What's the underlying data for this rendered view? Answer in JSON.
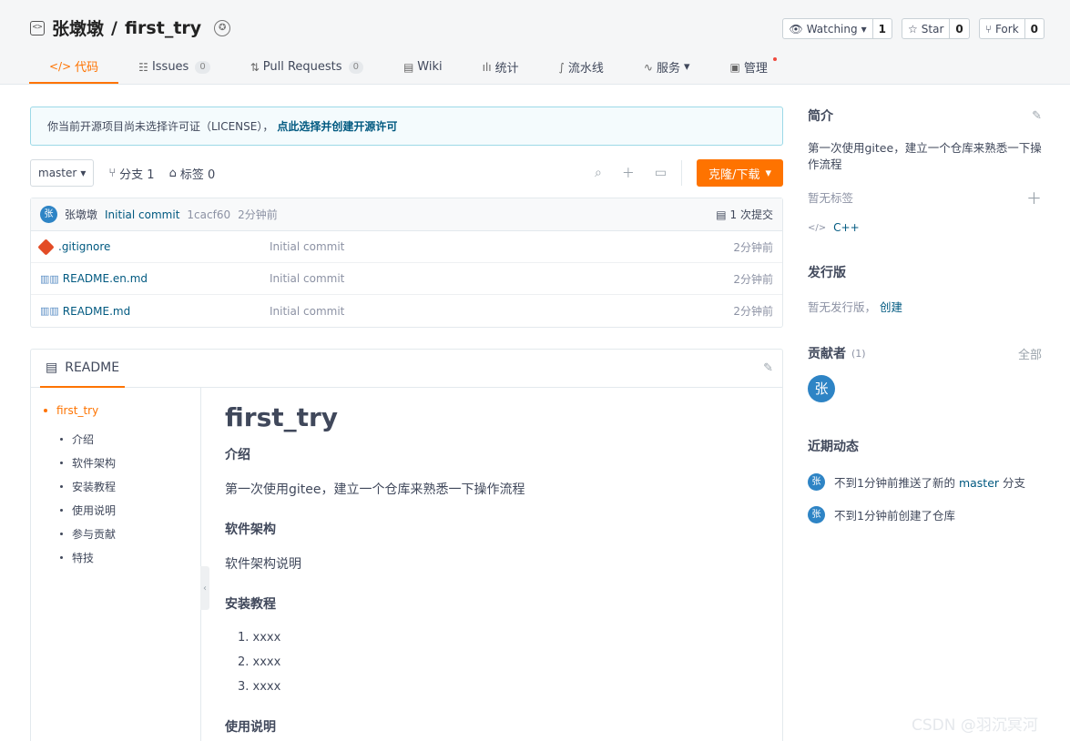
{
  "repo": {
    "owner": "张墩墩",
    "separator": "/",
    "name": "first_try",
    "title_icon": "code-repo-icon",
    "badge_icon": "recommend-badge-icon"
  },
  "actions": {
    "watch_label": "Watching",
    "watch_count": "1",
    "star_label": "Star",
    "star_count": "0",
    "fork_label": "Fork",
    "fork_count": "0"
  },
  "tabs": [
    {
      "label": "代码",
      "icon": "code-icon",
      "active": true
    },
    {
      "label": "Issues",
      "count": "0",
      "icon": "issues-icon"
    },
    {
      "label": "Pull Requests",
      "count": "0",
      "icon": "pull-request-icon"
    },
    {
      "label": "Wiki",
      "icon": "wiki-icon"
    },
    {
      "label": "统计",
      "icon": "chart-icon"
    },
    {
      "label": "流水线",
      "icon": "pipeline-icon"
    },
    {
      "label": "服务",
      "icon": "service-icon"
    },
    {
      "label": "管理",
      "icon": "manage-icon"
    }
  ],
  "license": {
    "text": "你当前开源项目尚未选择许可证（LICENSE），",
    "link": "点此选择并创建开源许可"
  },
  "branchbar": {
    "branch": "master",
    "branches_label": "分支 1",
    "tags_label": "标签 0",
    "clone_label": "克隆/下载"
  },
  "commit": {
    "avatar": "张",
    "author": "张墩墩",
    "message": "Initial commit",
    "hash": "1cacf60",
    "time": "2分钟前",
    "count_label": "1 次提交"
  },
  "files": [
    {
      "name": ".gitignore",
      "message": "Initial commit",
      "time": "2分钟前"
    },
    {
      "name": "README.en.md",
      "message": "Initial commit",
      "time": "2分钟前"
    },
    {
      "name": "README.md",
      "message": "Initial commit",
      "time": "2分钟前"
    }
  ],
  "readme": {
    "tab_label": "README",
    "toc_top": "first_try",
    "toc": [
      "介绍",
      "软件架构",
      "安装教程",
      "使用说明",
      "参与贡献",
      "特技"
    ],
    "title": "first_try",
    "intro_heading": "介绍",
    "intro_text": "第一次使用gitee，建立一个仓库来熟悉一下操作流程",
    "arch_heading": "软件架构",
    "arch_text": "软件架构说明",
    "install_heading": "安装教程",
    "install_steps": [
      "xxxx",
      "xxxx",
      "xxxx"
    ],
    "usage_heading": "使用说明"
  },
  "sidebar": {
    "intro_heading": "简介",
    "description": "第一次使用gitee，建立一个仓库来熟悉一下操作流程",
    "no_tags": "暂无标签",
    "language": "C++",
    "release_heading": "发行版",
    "no_release": "暂无发行版，",
    "create_link": "创建",
    "contributors_heading": "贡献者",
    "contributors_count": "(1)",
    "contributors_all": "全部",
    "contributor_avatar": "张",
    "activity_heading": "近期动态",
    "activities": [
      {
        "avatar": "张",
        "pre": "不到1分钟前推送了新的",
        "link": "master",
        "post": "分支"
      },
      {
        "avatar": "张",
        "pre": "不到1分钟前创建了仓库",
        "link": "",
        "post": ""
      }
    ]
  },
  "watermark": "CSDN @羽沉冥河",
  "colors": {
    "accent": "#fe7300",
    "link": "#005980",
    "avatar": "#2e84c5"
  }
}
